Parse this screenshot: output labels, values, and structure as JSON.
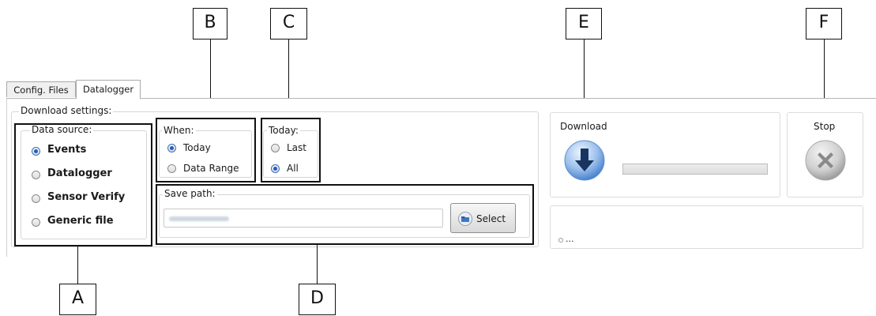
{
  "tabs": [
    {
      "label": "Config. Files"
    },
    {
      "label": "Datalogger"
    }
  ],
  "download_settings": {
    "title": "Download settings:",
    "data_source": {
      "title": "Data source:",
      "options": [
        {
          "label": "Events",
          "selected": true
        },
        {
          "label": "Datalogger",
          "selected": false
        },
        {
          "label": "Sensor Verify",
          "selected": false
        },
        {
          "label": "Generic file",
          "selected": false
        }
      ]
    },
    "when": {
      "title": "When:",
      "options": [
        {
          "label": "Today",
          "selected": true
        },
        {
          "label": "Data Range",
          "selected": false
        }
      ]
    },
    "today": {
      "title": "Today:",
      "options": [
        {
          "label": "Last",
          "selected": false
        },
        {
          "label": "All",
          "selected": true
        }
      ]
    },
    "save_path": {
      "title": "Save path:",
      "value": "",
      "select_label": "Select"
    }
  },
  "download": {
    "label": "Download",
    "progress": 0
  },
  "stop": {
    "label": "Stop"
  },
  "status": {
    "text": "..."
  },
  "annotations": {
    "A": "A",
    "B": "B",
    "C": "C",
    "D": "D",
    "E": "E",
    "F": "F"
  },
  "colors": {
    "accent": "#2c6bc9",
    "annotation": "#111111",
    "stop_gray": "#8a8a8a"
  },
  "icons": {
    "download": "download-arrow-icon",
    "stop": "close-x-icon",
    "folder": "folder-icon"
  }
}
